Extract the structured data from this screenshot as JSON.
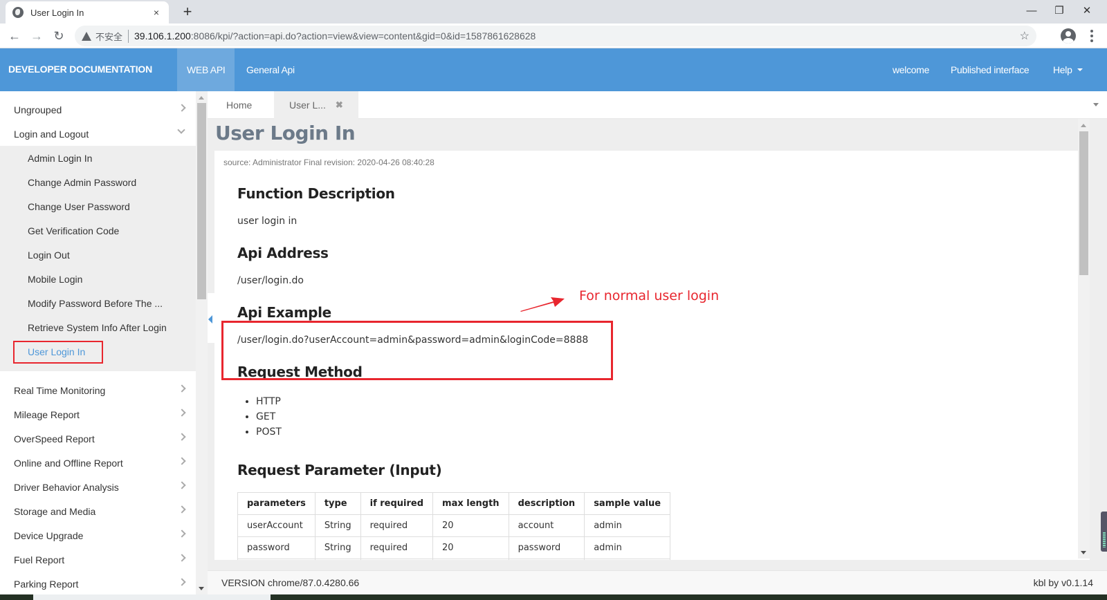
{
  "browser": {
    "tab_title": "User Login In",
    "tab_close": "×",
    "new_tab": "+",
    "window_controls": {
      "minimize": "—",
      "restore": "❐",
      "close": "✕"
    },
    "nav": {
      "back": "←",
      "forward": "→",
      "reload": "↻"
    },
    "security_label": "不安全",
    "url_host": "39.106.1.200",
    "url_rest": ":8086/kpi/?action=api.do?action=view&view=content&gid=0&id=1587861628628",
    "star": "☆"
  },
  "header": {
    "brand": "DEVELOPER DOCUMENTATION",
    "nav": [
      {
        "label": "WEB API",
        "active": true
      },
      {
        "label": "General Api",
        "active": false
      }
    ],
    "right": [
      {
        "label": "welcome"
      },
      {
        "label": "Published interface"
      },
      {
        "label": "Help"
      }
    ]
  },
  "sidebar": {
    "groups_top": [
      {
        "label": "Ungrouped",
        "expanded": false
      },
      {
        "label": "Login and Logout",
        "expanded": true
      }
    ],
    "subitems": [
      {
        "label": "Admin Login In"
      },
      {
        "label": "Change Admin Password"
      },
      {
        "label": "Change User Password"
      },
      {
        "label": "Get Verification Code"
      },
      {
        "label": "Login Out"
      },
      {
        "label": "Mobile Login"
      },
      {
        "label": "Modify Password Before The ..."
      },
      {
        "label": "Retrieve System Info After Login"
      },
      {
        "label": "User Login In",
        "active": true
      }
    ],
    "groups_bottom": [
      {
        "label": "Real Time Monitoring"
      },
      {
        "label": "Mileage Report"
      },
      {
        "label": "OverSpeed Report"
      },
      {
        "label": "Online and Offline Report"
      },
      {
        "label": "Driver Behavior Analysis"
      },
      {
        "label": "Storage and Media"
      },
      {
        "label": "Device Upgrade"
      },
      {
        "label": "Fuel Report"
      },
      {
        "label": "Parking Report"
      }
    ]
  },
  "content_tabs": [
    {
      "label": "Home",
      "active": false
    },
    {
      "label": "User L...",
      "active": true,
      "close": "✖"
    }
  ],
  "page": {
    "title": "User Login In",
    "meta": "source:  Administrator Final revision:  2020-04-26 08:40:28",
    "sections": {
      "function_description": {
        "heading": "Function Description",
        "text": "user login in"
      },
      "api_address": {
        "heading": "Api Address",
        "text": "/user/login.do"
      },
      "api_example": {
        "heading": "Api Example",
        "text": "/user/login.do?userAccount=admin&password=admin&loginCode=8888"
      },
      "request_method": {
        "heading": "Request Method",
        "items": [
          "HTTP",
          "GET",
          "POST"
        ]
      },
      "request_parameter": {
        "heading": "Request Parameter (Input)",
        "columns": [
          "parameters",
          "type",
          "if required",
          "max length",
          "description",
          "sample value"
        ],
        "rows": [
          [
            "userAccount",
            "String",
            "required",
            "20",
            "account",
            "admin"
          ],
          [
            "password",
            "String",
            "required",
            "20",
            "password",
            "admin"
          ]
        ]
      }
    }
  },
  "annotation": {
    "text": "For normal user login",
    "color": "#e8262e"
  },
  "footer": {
    "version": "VERSION chrome/87.0.4280.66",
    "by": "kbl by v0.1.14"
  },
  "colors": {
    "header_bg": "#4e97d8",
    "active_nav_bg": "#6ea9de",
    "accent": "#4e97d8",
    "annotation_red": "#e8262e"
  }
}
